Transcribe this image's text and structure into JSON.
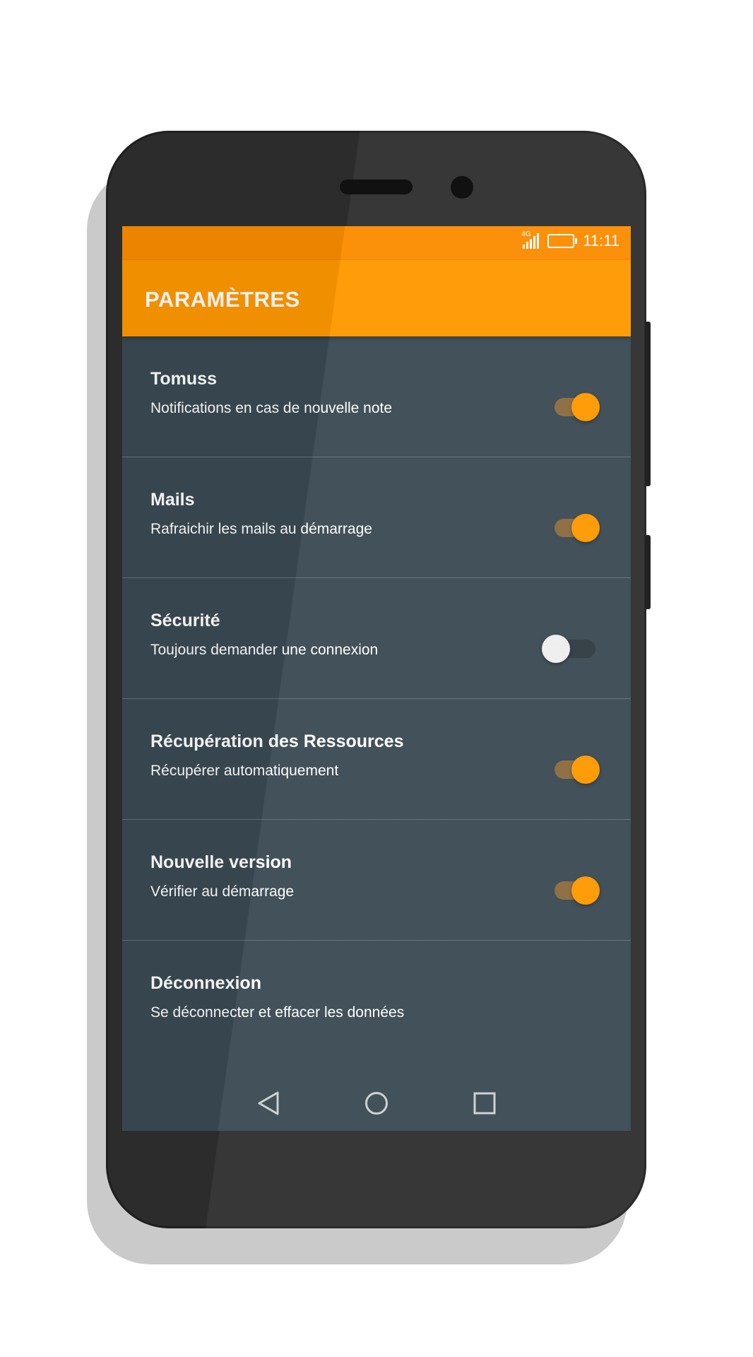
{
  "status": {
    "network": "4G",
    "time": "11:11",
    "icons": [
      "signal-icon",
      "battery-icon"
    ]
  },
  "app_bar": {
    "title": "PARAMÈTRES"
  },
  "settings": [
    {
      "title": "Tomuss",
      "subtitle": "Notifications en cas de nouvelle note",
      "toggle": true
    },
    {
      "title": "Mails",
      "subtitle": "Rafraichir les mails au démarrage",
      "toggle": true
    },
    {
      "title": "Sécurité",
      "subtitle": "Toujours demander une connexion",
      "toggle": false
    },
    {
      "title": "Récupération des Ressources",
      "subtitle": "Récupérer automatiquement",
      "toggle": true
    },
    {
      "title": "Nouvelle version",
      "subtitle": "Vérifier au démarrage",
      "toggle": true
    },
    {
      "title": "Déconnexion",
      "subtitle": "Se déconnecter et effacer les données",
      "toggle": null
    }
  ],
  "nav": {
    "icons": [
      "back-icon",
      "home-icon",
      "recents-icon"
    ]
  },
  "colors": {
    "accent": "#ff9800",
    "status_bar": "#fb8c00",
    "background": "#3a4a53"
  }
}
